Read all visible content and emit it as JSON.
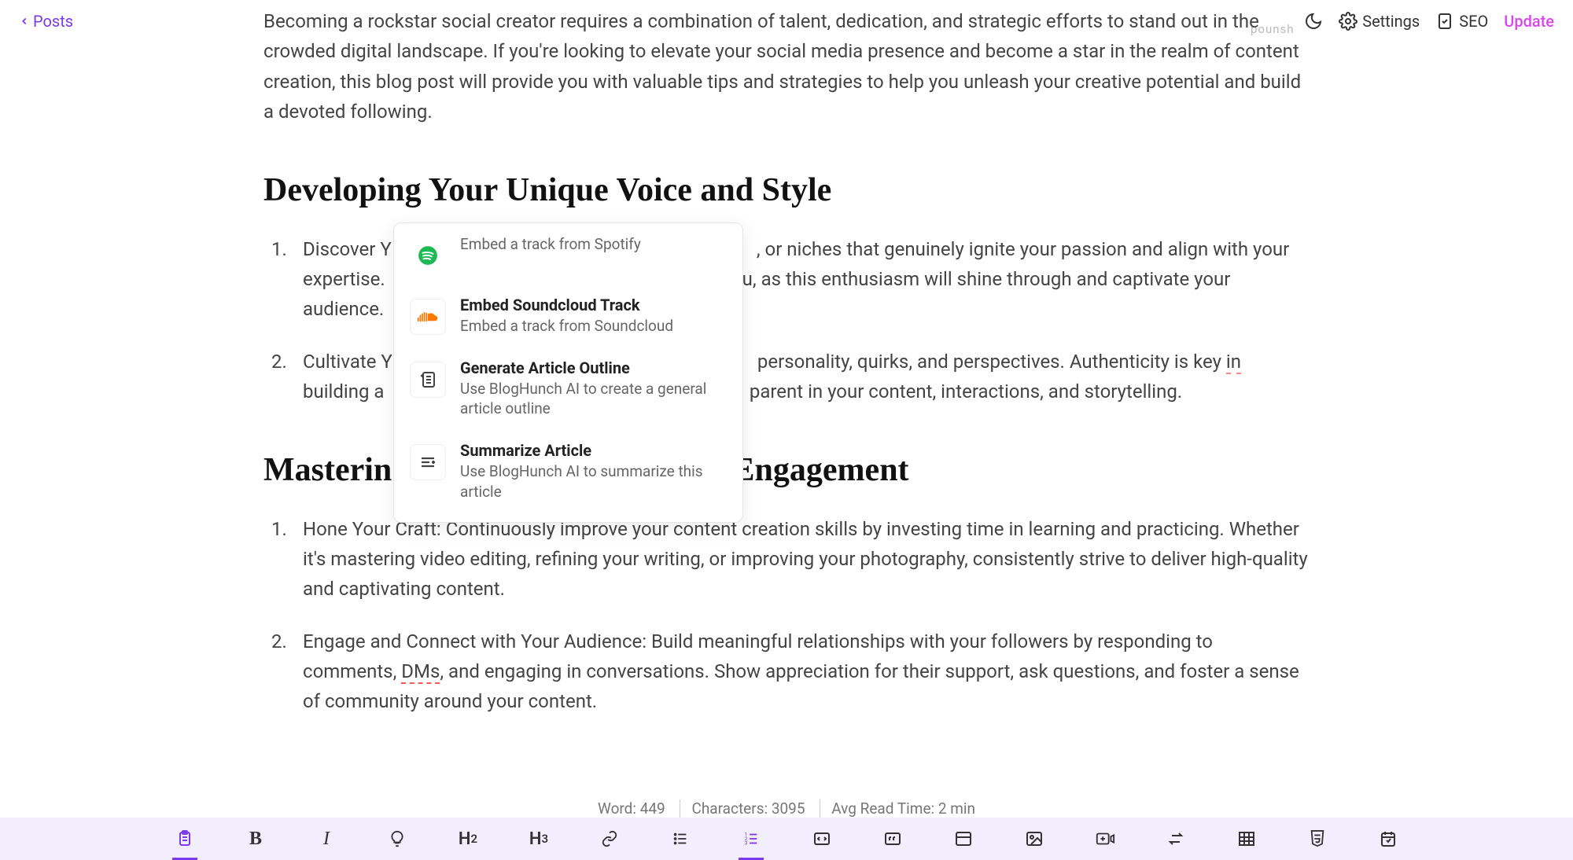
{
  "topbar": {
    "back_label": "Posts",
    "watermark": "pounsh",
    "settings_label": "Settings",
    "seo_label": "SEO",
    "update_label": "Update"
  },
  "content": {
    "intro": "Becoming a rockstar social creator requires a combination of talent, dedication, and strategic efforts to stand out in the crowded digital landscape. If you're looking to elevate your social media presence and become a star in the realm of content creation, this blog post will provide you with valuable tips and strategies to help you unleash your creative potential and build a devoted following.",
    "h2_a": "Developing Your Unique Voice and Style",
    "list_a": [
      {
        "prefix": "Discover Y",
        "mid": ", or niches that genuinely ignite your passion and align with your expertise.",
        "mid2": "ou, as this enthusiasm will shine through and captivate your audience."
      },
      {
        "prefix": "Cultivate Y",
        "mid": "personality, quirks, and perspectives. Authenticity is key ",
        "in_word": "in",
        "mid2": " building a",
        "tail": "parent in your content, interactions, and storytelling."
      }
    ],
    "h2_b_left": "Masterin",
    "h2_b_right": " Engagement",
    "list_b": [
      "Hone Your Craft: Continuously improve your content creation skills by investing time in learning and practicing. Whether it's mastering video editing, refining your writing, or improving your photography, consistently strive to deliver high-quality and captivating content.",
      "Engage and Connect with Your Audience: Build meaningful relationships with your followers by responding to comments, DMs, and engaging in conversations. Show appreciation for their support, ask questions, and foster a sense of community around your content."
    ],
    "dm_word": "DMs"
  },
  "slash_menu": {
    "spotify_desc": "Embed a track from Spotify",
    "items": [
      {
        "title": "Embed Soundcloud Track",
        "desc": "Embed a track from Soundcloud",
        "icon": "soundcloud"
      },
      {
        "title": "Generate Article Outline",
        "desc": "Use BlogHunch AI to create a general article outline",
        "icon": "outline"
      },
      {
        "title": "Summarize Article",
        "desc": "Use BlogHunch AI to summarize this article",
        "icon": "summarize"
      }
    ]
  },
  "stats": {
    "word": "Word: 449",
    "chars": "Characters: 3095",
    "read": "Avg Read Time: 2 min"
  }
}
